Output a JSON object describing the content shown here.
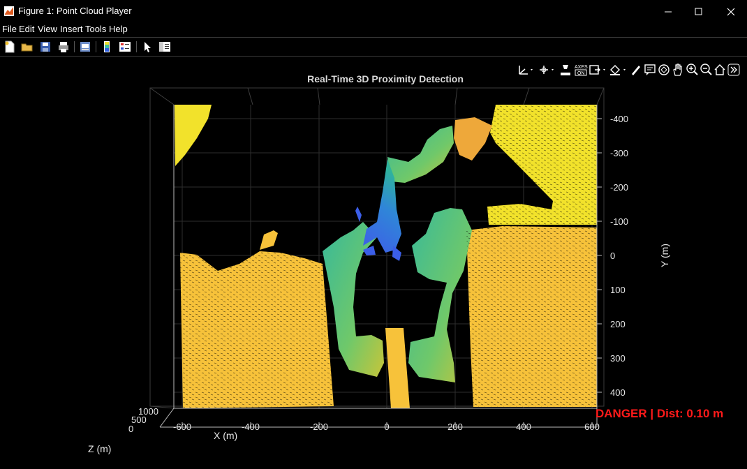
{
  "window": {
    "title": "Figure 1: Point Cloud Player",
    "minimize_icon": "minimize-icon",
    "maximize_icon": "maximize-icon",
    "close_icon": "close-icon"
  },
  "menu": [
    "File",
    "Edit",
    "View",
    "Insert",
    "Tools",
    "Help"
  ],
  "toolbar": [
    "new-figure-icon",
    "open-icon",
    "save-icon",
    "print-icon",
    "print-preview-icon",
    "colorbar-icon",
    "legend-icon",
    "pointer-icon",
    "property-inspector-icon"
  ],
  "axes_toolbar": [
    "rotate-axes-icon",
    "data-tips-icon",
    "brush-icon",
    "axes-toggle-icon",
    "export-icon",
    "fill-icon",
    "pen-icon",
    "annotate-icon",
    "rotate-3d-icon",
    "pan-icon",
    "zoom-in-icon",
    "zoom-out-icon",
    "home-icon",
    "more-icon"
  ],
  "colors": {
    "background": "#000000",
    "danger": "#ff1a1a",
    "yellow": "#f2e22b",
    "orange": "#f7c23a",
    "green": "#3ec08a",
    "blue": "#3b5ee8"
  },
  "chart_data": {
    "type": "scatter",
    "title": "Real-Time 3D Proximity Detection",
    "xlabel": "X (m)",
    "ylabel": "Y (m)",
    "zlabel": "Z (m)",
    "xlim": [
      -650,
      620
    ],
    "ylim": [
      -450,
      440
    ],
    "x_ticks": [
      "-600",
      "-400",
      "-200",
      "0",
      "200",
      "400",
      "600"
    ],
    "y_ticks": [
      "-400",
      "-300",
      "-200",
      "-100",
      "0",
      "100",
      "200",
      "300",
      "400"
    ],
    "z_ticks": [
      "1000",
      "500",
      "0"
    ],
    "grid": true,
    "colormap": "parula",
    "annotation": "DANGER | Dist: 0.10 m"
  }
}
